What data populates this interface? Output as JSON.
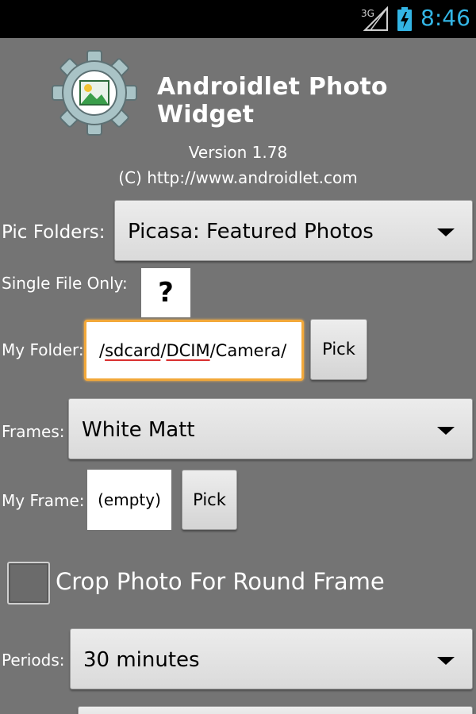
{
  "status_bar": {
    "network": "3G",
    "time": "8:46",
    "clock_color": "#33b5e5"
  },
  "header": {
    "app_title": "Androidlet Photo Widget",
    "version": "Version 1.78",
    "copyright": "(C) http://www.androidlet.com",
    "icon": "gear-photo-icon"
  },
  "form": {
    "pic_folders": {
      "label": "Pic Folders:",
      "value": "Picasa: Featured Photos"
    },
    "single_file": {
      "label": "Single File Only:",
      "help": "?"
    },
    "my_folder": {
      "label": "My Folder:",
      "path_parts": [
        "/",
        "sdcard",
        "/",
        "DCIM",
        "/Camera/"
      ],
      "pick_label": "Pick"
    },
    "frames": {
      "label": "Frames:",
      "value": "White Matt"
    },
    "my_frame": {
      "label": "My Frame:",
      "value": "(empty)",
      "pick_label": "Pick"
    },
    "crop": {
      "label": "Crop Photo For Round Frame",
      "checked": false
    },
    "periods": {
      "label": "Periods:",
      "value": "30 minutes"
    }
  },
  "colors": {
    "background": "#747474",
    "focus_border": "#f2a83a",
    "spellcheck_underline": "#d93030"
  }
}
